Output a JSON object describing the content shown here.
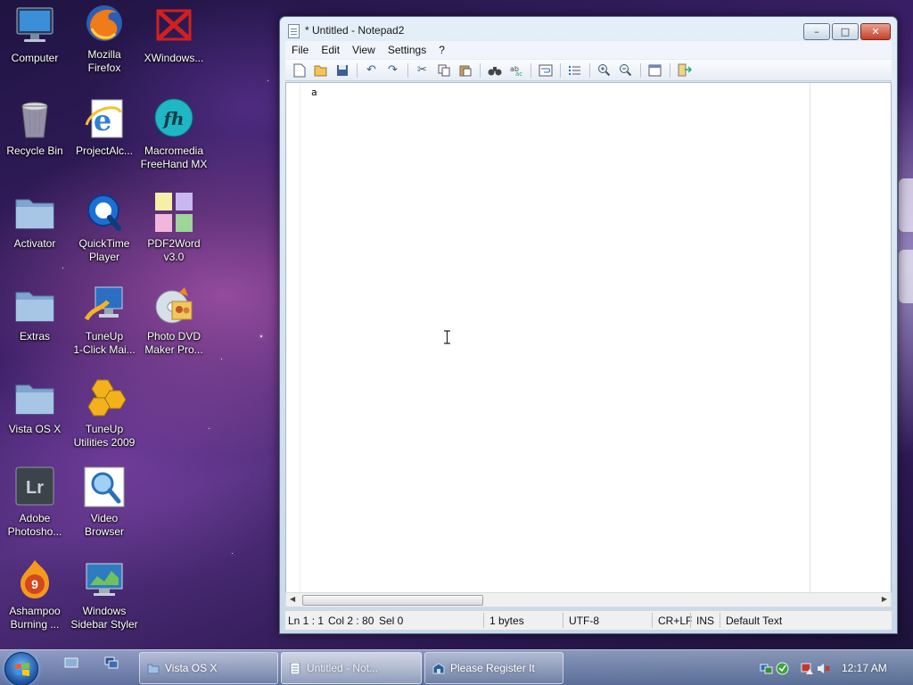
{
  "desktop": {
    "icons": [
      {
        "name": "computer",
        "label": "Computer"
      },
      {
        "name": "mozilla-firefox",
        "label": "Mozilla\nFirefox"
      },
      {
        "name": "xwindows",
        "label": "XWindows..."
      },
      {
        "name": "recycle-bin",
        "label": "Recycle Bin"
      },
      {
        "name": "projectalc",
        "label": "ProjectAlc..."
      },
      {
        "name": "macromedia-freehand",
        "label": "Macromedia\nFreeHand MX"
      },
      {
        "name": "activator",
        "label": "Activator"
      },
      {
        "name": "quicktime-player",
        "label": "QuickTime\nPlayer"
      },
      {
        "name": "pdf2word",
        "label": "PDF2Word\nv3.0"
      },
      {
        "name": "extras",
        "label": "Extras"
      },
      {
        "name": "tuneup-1click",
        "label": "TuneUp\n1-Click Mai..."
      },
      {
        "name": "photo-dvd-maker",
        "label": "Photo DVD\nMaker Pro..."
      },
      {
        "name": "vista-os-x",
        "label": "Vista OS X"
      },
      {
        "name": "tuneup-utilities",
        "label": "TuneUp\nUtilities 2009"
      },
      {
        "name": "adobe-photoshop",
        "label": "Adobe\nPhotosho..."
      },
      {
        "name": "video-browser",
        "label": "Video\nBrowser"
      },
      {
        "name": "ashampoo-burning",
        "label": "Ashampoo\nBurning ..."
      },
      {
        "name": "windows-sidebar-styler",
        "label": "Windows\nSidebar Styler"
      }
    ]
  },
  "notepad": {
    "title": "* Untitled - Notepad2",
    "menu": [
      "File",
      "Edit",
      "View",
      "Settings",
      "?"
    ],
    "toolbar_icons": [
      "new-icon",
      "open-icon",
      "save-icon",
      "undo-icon",
      "redo-icon",
      "cut-icon",
      "copy-icon",
      "paste-icon",
      "find-icon",
      "replace-icon",
      "word-wrap-icon",
      "line-numbers-icon",
      "zoom-in-icon",
      "zoom-out-icon",
      "scheme-icon",
      "exit-icon"
    ],
    "content": "a",
    "status": {
      "position": "Ln 1 : 1",
      "column": "Col 2 : 80",
      "selection": "Sel 0",
      "size": "1 bytes",
      "encoding": "UTF-8",
      "line_endings": "CR+LF",
      "mode": "INS",
      "scheme": "Default Text"
    }
  },
  "taskbar": {
    "buttons": [
      {
        "name": "taskbar-vista-os-x",
        "label": "Vista OS X",
        "active": false
      },
      {
        "name": "taskbar-notepad",
        "label": "Untitled - Not...",
        "active": true
      },
      {
        "name": "taskbar-please-register",
        "label": "Please Register It",
        "active": false
      }
    ],
    "clock": "12:17 AM"
  },
  "colors": {
    "close_button": "#c4402a",
    "folder": "#8fb3d8",
    "taskbar": "#8aa6c8"
  }
}
